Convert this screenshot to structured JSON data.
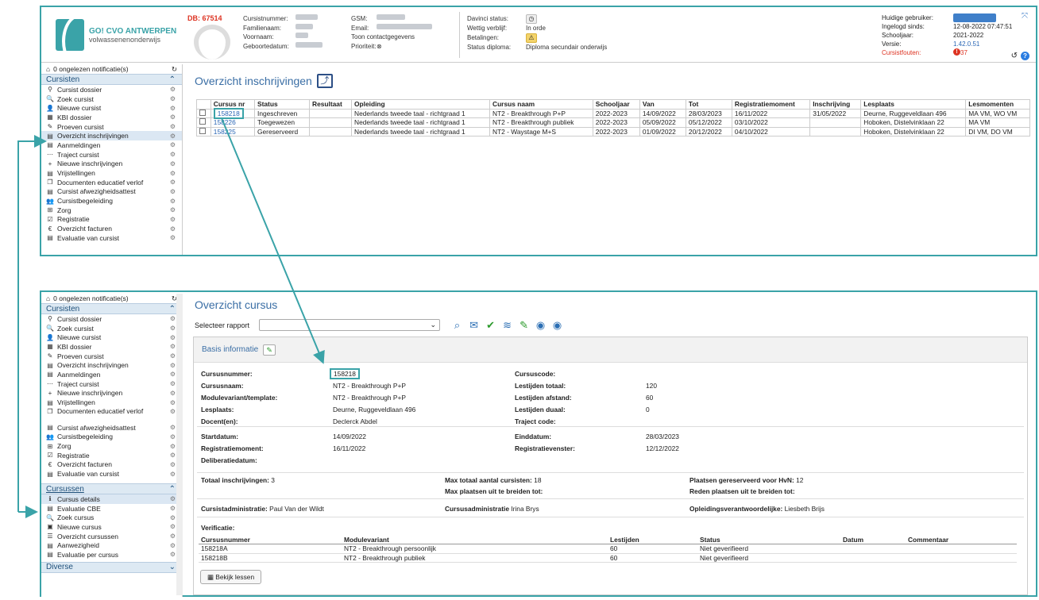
{
  "header": {
    "logo_line1": "GO! CVO ANTWERPEN",
    "logo_line2": "volwassenenonderwijs",
    "db": "DB: 67514",
    "col1": [
      {
        "k": "Cursistnummer:",
        "blur": 28
      },
      {
        "k": "Familienaam:",
        "blur": 22
      },
      {
        "k": "Voornaam:",
        "blur": 16
      },
      {
        "k": "Geboortedatum:",
        "blur": 34
      }
    ],
    "col2": [
      {
        "k": "GSM:",
        "blur": 36
      },
      {
        "k": "Email:",
        "blur": 70
      },
      {
        "link": "Toon contactgegevens"
      },
      {
        "k": "Prioriteit:",
        "v": "⊗"
      }
    ],
    "col3": [
      {
        "k": "Davinci status:",
        "icon": "clock-icon"
      },
      {
        "k": "Wettig verblijf:",
        "v": "In orde"
      },
      {
        "k": "Betalingen:",
        "icon": "warning-icon"
      },
      {
        "k": "Status diploma:",
        "v": "Diploma secundair onderwijs"
      }
    ],
    "right": [
      {
        "k": "Huidige gebruiker:",
        "user": true
      },
      {
        "k": "Ingelogd sinds:",
        "v": "12-08-2022 07:47:51"
      },
      {
        "k": "Schooljaar:",
        "v": "2021-2022"
      },
      {
        "k": "Versie:",
        "v": "1.42.0.51"
      },
      {
        "k": "Cursistfouten:",
        "v": "37"
      }
    ]
  },
  "sidebar_top": {
    "notif": "0 ongelezen notificatie(s)",
    "section": "Cursisten",
    "items": [
      {
        "icon": "person-icon",
        "g": "⚲",
        "label": "Cursist dossier"
      },
      {
        "icon": "search-icon",
        "g": "🔍",
        "label": "Zoek cursist"
      },
      {
        "icon": "add-user-icon",
        "g": "👤",
        "label": "Nieuwe cursist"
      },
      {
        "icon": "kbi-icon",
        "g": "▦",
        "label": "KBI dossier"
      },
      {
        "icon": "pencil-icon",
        "g": "✎",
        "label": "Proeven cursist"
      },
      {
        "icon": "list-icon",
        "g": "▤",
        "label": "Overzicht inschrijvingen",
        "sel": true
      },
      {
        "icon": "list-icon",
        "g": "▤",
        "label": "Aanmeldingen"
      },
      {
        "icon": "route-icon",
        "g": "⋯",
        "label": "Traject cursist"
      },
      {
        "icon": "plus-icon",
        "g": "+",
        "label": "Nieuwe inschrijvingen"
      },
      {
        "icon": "list-icon",
        "g": "▤",
        "label": "Vrijstellingen"
      },
      {
        "icon": "documents-icon",
        "g": "❐",
        "label": "Documenten educatief verlof"
      },
      {
        "icon": "list-icon",
        "g": "▤",
        "label": "Cursist afwezigheidsattest"
      },
      {
        "icon": "group-icon",
        "g": "👥",
        "label": "Cursistbegeleiding"
      },
      {
        "icon": "care-icon",
        "g": "⊞",
        "label": "Zorg"
      },
      {
        "icon": "edit-icon",
        "g": "☑",
        "label": "Registratie"
      },
      {
        "icon": "euro-icon",
        "g": "€",
        "label": "Overzicht facturen"
      },
      {
        "icon": "list-icon",
        "g": "▤",
        "label": "Evaluatie van cursist"
      }
    ]
  },
  "overzicht": {
    "title": "Overzicht inschrijvingen",
    "columns": [
      "",
      "Cursus nr",
      "Status",
      "Resultaat",
      "Opleiding",
      "Cursus naam",
      "Schooljaar",
      "Van",
      "Tot",
      "Registratiemoment",
      "Inschrijving",
      "Lesplaats",
      "Lesmomenten"
    ],
    "rows": [
      [
        "",
        "158218",
        "Ingeschreven",
        "",
        "Nederlands tweede taal - richtgraad 1",
        "NT2 - Breakthrough P+P",
        "2022-2023",
        "14/09/2022",
        "28/03/2023",
        "16/11/2022",
        "31/05/2022",
        "Deurne, Ruggeveldlaan 496",
        "MA VM, WO VM"
      ],
      [
        "",
        "158226",
        "Toegewezen",
        "",
        "Nederlands tweede taal - richtgraad 1",
        "NT2 - Breakthrough publiek",
        "2022-2023",
        "05/09/2022",
        "05/12/2022",
        "03/10/2022",
        "",
        "Hoboken, Distelvinklaan 22",
        "MA VM"
      ],
      [
        "",
        "158225",
        "Gereserveerd",
        "",
        "Nederlands tweede taal - richtgraad 1",
        "NT2 - Waystage M+S",
        "2022-2023",
        "01/09/2022",
        "20/12/2022",
        "04/10/2022",
        "",
        "Hoboken, Distelvinklaan 22",
        "DI VM, DO VM"
      ]
    ]
  },
  "sidebar_bot": {
    "notif": "0 ongelezen notificatie(s)",
    "section1": "Cursisten",
    "items1": [
      {
        "g": "⚲",
        "label": "Cursist dossier"
      },
      {
        "g": "🔍",
        "label": "Zoek cursist"
      },
      {
        "g": "👤",
        "label": "Nieuwe cursist"
      },
      {
        "g": "▦",
        "label": "KBI dossier"
      },
      {
        "g": "✎",
        "label": "Proeven cursist"
      },
      {
        "g": "▤",
        "label": "Overzicht inschrijvingen"
      },
      {
        "g": "▤",
        "label": "Aanmeldingen"
      },
      {
        "g": "⋯",
        "label": "Traject cursist"
      },
      {
        "g": "+",
        "label": "Nieuwe inschrijvingen"
      },
      {
        "g": "▤",
        "label": "Vrijstellingen"
      },
      {
        "g": "❐",
        "label": "Documenten educatief verlof",
        "tall": true
      },
      {
        "g": "▤",
        "label": "Cursist afwezigheidsattest"
      },
      {
        "g": "👥",
        "label": "Cursistbegeleiding"
      },
      {
        "g": "⊞",
        "label": "Zorg"
      },
      {
        "g": "☑",
        "label": "Registratie"
      },
      {
        "g": "€",
        "label": "Overzicht facturen"
      },
      {
        "g": "▤",
        "label": "Evaluatie van cursist"
      }
    ],
    "section2": "Cursussen",
    "items2": [
      {
        "g": "ℹ",
        "label": "Cursus details",
        "sel": true
      },
      {
        "g": "▤",
        "label": "Evaluatie CBE"
      },
      {
        "g": "🔍",
        "label": "Zoek cursus"
      },
      {
        "g": "▣",
        "label": "Nieuwe cursus"
      },
      {
        "g": "☰",
        "label": "Overzicht cursussen"
      },
      {
        "g": "▤",
        "label": "Aanwezigheid"
      },
      {
        "g": "▤",
        "label": "Evaluatie per cursus"
      }
    ],
    "section3": "Diverse"
  },
  "cursus": {
    "title": "Overzicht cursus",
    "report_label": "Selecteer rapport",
    "card_title": "Basis informatie",
    "left": [
      {
        "k": "Cursusnummer:",
        "v": "158218"
      },
      {
        "k": "Cursusnaam:",
        "v": "NT2 - Breakthrough P+P"
      },
      {
        "k": "Modulevariant/template:",
        "v": "NT2 - Breakthrough P+P"
      },
      {
        "k": "Lesplaats:",
        "v": "Deurne, Ruggeveldlaan 496"
      },
      {
        "k": "Docent(en):",
        "v": "Declerck Abdel"
      }
    ],
    "right": [
      {
        "k": "Cursuscode:",
        "v": ""
      },
      {
        "k": "Lestijden totaal:",
        "v": "120"
      },
      {
        "k": "Lestijden afstand:",
        "v": "60"
      },
      {
        "k": "Lestijden duaal:",
        "v": "0"
      },
      {
        "k": "Traject code:",
        "v": ""
      }
    ],
    "dates_left": [
      {
        "k": "Startdatum:",
        "v": "14/09/2022"
      },
      {
        "k": "Registratiemoment:",
        "v": "16/11/2022"
      },
      {
        "k": "Deliberatiedatum:",
        "v": ""
      }
    ],
    "dates_right": [
      {
        "k": "Einddatum:",
        "v": "28/03/2023"
      },
      {
        "k": "Registratievenster:",
        "v": "12/12/2022"
      }
    ],
    "totaal": {
      "k": "Totaal inschrijvingen:",
      "v": "3"
    },
    "max1": {
      "k": "Max totaal aantal cursisten:",
      "v": "18"
    },
    "max2": {
      "k": "Max plaatsen uit te breiden tot:",
      "v": ""
    },
    "plaatsen": {
      "k": "Plaatsen gereserveerd voor HvN:",
      "v": "12"
    },
    "reden": {
      "k": "Reden plaatsen uit te breiden tot:",
      "v": ""
    },
    "admin1": {
      "k": "Cursistadministratie:",
      "v": "Paul Van der Wildt"
    },
    "admin2": {
      "k": "Cursusadministratie",
      "v": "Irina Brys"
    },
    "admin3": {
      "k": "Opleidingsverantwoordelijke:",
      "v": "Liesbeth Brijs"
    },
    "verif_label": "Verificatie:",
    "verif_cols": [
      "Cursusnummer",
      "Modulevariant",
      "Lestijden",
      "Status",
      "Datum",
      "Commentaar"
    ],
    "verif_rows": [
      [
        "158218A",
        "NT2 - Breakthrough persoonlijk",
        "60",
        "Niet geverifieerd",
        "",
        ""
      ],
      [
        "158218B",
        "NT2 - Breakthrough publiek",
        "60",
        "Niet geverifieerd",
        "",
        ""
      ]
    ],
    "lessen_btn": "Bekijk lessen"
  }
}
